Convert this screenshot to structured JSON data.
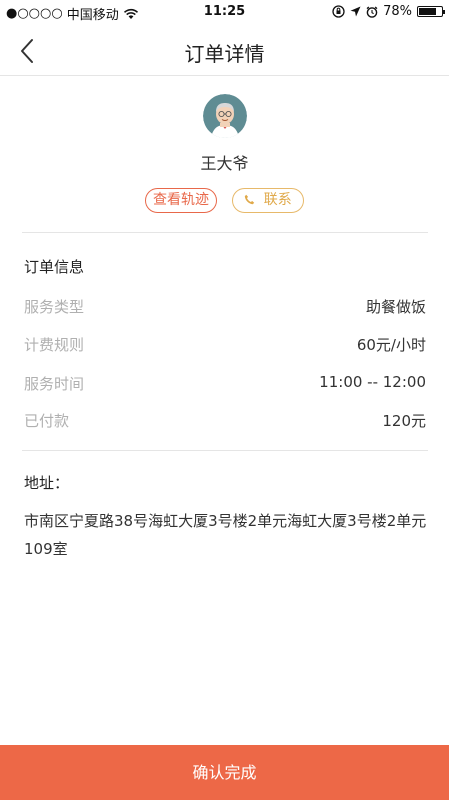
{
  "status_bar": {
    "signal": "●○○○○",
    "carrier": "中国移动",
    "time": "11:25",
    "battery": "78%",
    "battery_level": 0.78,
    "icons": [
      "wifi-icon",
      "lock-rotation-icon",
      "location-arrow-icon",
      "alarm-icon",
      "battery-icon"
    ]
  },
  "nav": {
    "title": "订单详情",
    "back_icon": "chevron-left-icon"
  },
  "profile": {
    "name": "王大爷",
    "track_label": "查看轨迹",
    "contact_label": "联系",
    "contact_icon": "phone-icon"
  },
  "order_info": {
    "title": "订单信息",
    "rows": [
      {
        "label": "服务类型",
        "value": "助餐做饭"
      },
      {
        "label": "计费规则",
        "value": "60元/小时"
      },
      {
        "label": "服务时间",
        "value": "11:00 -- 12:00"
      },
      {
        "label": "已付款",
        "value": "120元"
      }
    ]
  },
  "address": {
    "title": "地址：",
    "text": "市南区宁夏路38号海虹大厦3号楼2单元海虹大厦3号楼2单元109室"
  },
  "footer": {
    "confirm_label": "确认完成"
  },
  "colors": {
    "accent": "#ed6847",
    "track_border": "#e8684a",
    "contact_border": "#e7b96a",
    "label_gray": "#b0b0b0"
  }
}
